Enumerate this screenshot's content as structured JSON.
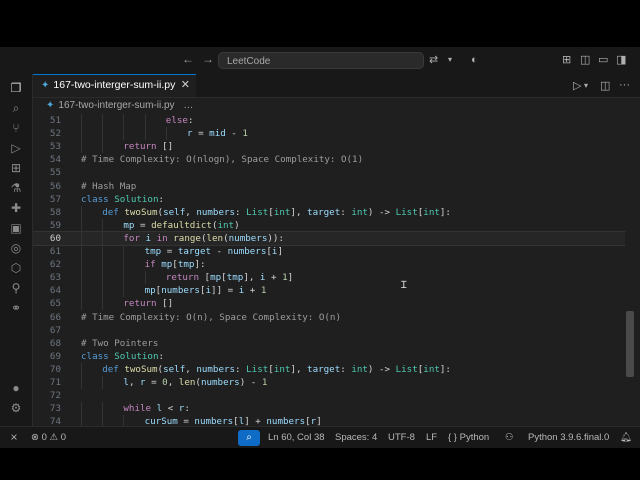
{
  "titlebar": {
    "search_label": "LeetCode",
    "back_icon": "arrow-left-icon",
    "forward_icon": "arrow-right-icon"
  },
  "tab": {
    "label": "167-two-interger-sum-ii.py",
    "close": "✕"
  },
  "breadcrumb": {
    "file": "167-two-interger-sum-ii.py",
    "more": "…"
  },
  "code_lines": [
    {
      "n": "51",
      "indent": 4,
      "tokens": [
        [
          "k",
          "else"
        ],
        [
          "o",
          ":"
        ]
      ]
    },
    {
      "n": "52",
      "indent": 5,
      "tokens": [
        [
          "v",
          "r"
        ],
        [
          "o",
          " = "
        ],
        [
          "v",
          "mid"
        ],
        [
          "o",
          " - "
        ],
        [
          "n",
          "1"
        ]
      ]
    },
    {
      "n": "53",
      "indent": 2,
      "tokens": [
        [
          "k",
          "return"
        ],
        [
          "o",
          " []"
        ]
      ]
    },
    {
      "n": "54",
      "indent": 0,
      "tokens": [
        [
          "cm",
          "# Time Complexity: O(nlogn), Space Complexity: O(1)"
        ]
      ]
    },
    {
      "n": "55",
      "indent": 0,
      "tokens": []
    },
    {
      "n": "56",
      "indent": 0,
      "tokens": [
        [
          "cm",
          "# Hash Map"
        ]
      ]
    },
    {
      "n": "57",
      "indent": 0,
      "tokens": [
        [
          "kw",
          "class"
        ],
        [
          "o",
          " "
        ],
        [
          "c",
          "Solution"
        ],
        [
          "o",
          ":"
        ]
      ]
    },
    {
      "n": "58",
      "indent": 1,
      "tokens": [
        [
          "kw",
          "def"
        ],
        [
          "o",
          " "
        ],
        [
          "f",
          "twoSum"
        ],
        [
          "o",
          "("
        ],
        [
          "v",
          "self"
        ],
        [
          "o",
          ", "
        ],
        [
          "v",
          "numbers"
        ],
        [
          "o",
          ": "
        ],
        [
          "c",
          "List"
        ],
        [
          "o",
          "["
        ],
        [
          "c",
          "int"
        ],
        [
          "o",
          "], "
        ],
        [
          "v",
          "target"
        ],
        [
          "o",
          ": "
        ],
        [
          "c",
          "int"
        ],
        [
          "o",
          ") -> "
        ],
        [
          "c",
          "List"
        ],
        [
          "o",
          "["
        ],
        [
          "c",
          "int"
        ],
        [
          "o",
          "]:"
        ]
      ]
    },
    {
      "n": "59",
      "indent": 2,
      "tokens": [
        [
          "v",
          "mp"
        ],
        [
          "o",
          " = "
        ],
        [
          "f",
          "defaultdict"
        ],
        [
          "o",
          "("
        ],
        [
          "c",
          "int"
        ],
        [
          "o",
          ")"
        ]
      ]
    },
    {
      "n": "60",
      "indent": 2,
      "tokens": [
        [
          "k",
          "for"
        ],
        [
          "o",
          " "
        ],
        [
          "v",
          "i"
        ],
        [
          "o",
          " "
        ],
        [
          "k",
          "in"
        ],
        [
          "o",
          " "
        ],
        [
          "f",
          "range"
        ],
        [
          "o",
          "("
        ],
        [
          "f",
          "len"
        ],
        [
          "o",
          "("
        ],
        [
          "v",
          "numbers"
        ],
        [
          "o",
          "))"
        ],
        [
          "o",
          ":"
        ]
      ]
    },
    {
      "n": "61",
      "indent": 3,
      "tokens": [
        [
          "v",
          "tmp"
        ],
        [
          "o",
          " = "
        ],
        [
          "v",
          "target"
        ],
        [
          "o",
          " - "
        ],
        [
          "v",
          "numbers"
        ],
        [
          "o",
          "["
        ],
        [
          "v",
          "i"
        ],
        [
          "o",
          "]"
        ]
      ]
    },
    {
      "n": "62",
      "indent": 3,
      "tokens": [
        [
          "k",
          "if"
        ],
        [
          "o",
          " "
        ],
        [
          "v",
          "mp"
        ],
        [
          "o",
          "["
        ],
        [
          "v",
          "tmp"
        ],
        [
          "o",
          "]:"
        ]
      ]
    },
    {
      "n": "63",
      "indent": 4,
      "tokens": [
        [
          "k",
          "return"
        ],
        [
          "o",
          " ["
        ],
        [
          "v",
          "mp"
        ],
        [
          "o",
          "["
        ],
        [
          "v",
          "tmp"
        ],
        [
          "o",
          "], "
        ],
        [
          "v",
          "i"
        ],
        [
          "o",
          " + "
        ],
        [
          "n",
          "1"
        ],
        [
          "o",
          "]"
        ]
      ]
    },
    {
      "n": "64",
      "indent": 3,
      "tokens": [
        [
          "v",
          "mp"
        ],
        [
          "o",
          "["
        ],
        [
          "v",
          "numbers"
        ],
        [
          "o",
          "["
        ],
        [
          "v",
          "i"
        ],
        [
          "o",
          "]] = "
        ],
        [
          "v",
          "i"
        ],
        [
          "o",
          " + "
        ],
        [
          "n",
          "1"
        ]
      ]
    },
    {
      "n": "65",
      "indent": 2,
      "tokens": [
        [
          "k",
          "return"
        ],
        [
          "o",
          " []"
        ]
      ]
    },
    {
      "n": "66",
      "indent": 0,
      "tokens": [
        [
          "cm",
          "# Time Complexity: O(n), Space Complexity: O(n)"
        ]
      ]
    },
    {
      "n": "67",
      "indent": 0,
      "tokens": []
    },
    {
      "n": "68",
      "indent": 0,
      "tokens": [
        [
          "cm",
          "# Two Pointers"
        ]
      ]
    },
    {
      "n": "69",
      "indent": 0,
      "tokens": [
        [
          "kw",
          "class"
        ],
        [
          "o",
          " "
        ],
        [
          "c",
          "Solution"
        ],
        [
          "o",
          ":"
        ]
      ]
    },
    {
      "n": "70",
      "indent": 1,
      "tokens": [
        [
          "kw",
          "def"
        ],
        [
          "o",
          " "
        ],
        [
          "f",
          "twoSum"
        ],
        [
          "o",
          "("
        ],
        [
          "v",
          "self"
        ],
        [
          "o",
          ", "
        ],
        [
          "v",
          "numbers"
        ],
        [
          "o",
          ": "
        ],
        [
          "c",
          "List"
        ],
        [
          "o",
          "["
        ],
        [
          "c",
          "int"
        ],
        [
          "o",
          "], "
        ],
        [
          "v",
          "target"
        ],
        [
          "o",
          ": "
        ],
        [
          "c",
          "int"
        ],
        [
          "o",
          ") -> "
        ],
        [
          "c",
          "List"
        ],
        [
          "o",
          "["
        ],
        [
          "c",
          "int"
        ],
        [
          "o",
          "]:"
        ]
      ]
    },
    {
      "n": "71",
      "indent": 2,
      "tokens": [
        [
          "v",
          "l"
        ],
        [
          "o",
          ", "
        ],
        [
          "v",
          "r"
        ],
        [
          "o",
          " = "
        ],
        [
          "n",
          "0"
        ],
        [
          "o",
          ", "
        ],
        [
          "f",
          "len"
        ],
        [
          "o",
          "("
        ],
        [
          "v",
          "numbers"
        ],
        [
          "o",
          ") - "
        ],
        [
          "n",
          "1"
        ]
      ]
    },
    {
      "n": "72",
      "indent": 0,
      "tokens": []
    },
    {
      "n": "73",
      "indent": 2,
      "tokens": [
        [
          "k",
          "while"
        ],
        [
          "o",
          " "
        ],
        [
          "v",
          "l"
        ],
        [
          "o",
          " < "
        ],
        [
          "v",
          "r"
        ],
        [
          "o",
          ":"
        ]
      ]
    },
    {
      "n": "74",
      "indent": 3,
      "tokens": [
        [
          "v",
          "curSum"
        ],
        [
          "o",
          " = "
        ],
        [
          "v",
          "numbers"
        ],
        [
          "o",
          "["
        ],
        [
          "v",
          "l"
        ],
        [
          "o",
          "] + "
        ],
        [
          "v",
          "numbers"
        ],
        [
          "o",
          "["
        ],
        [
          "v",
          "r"
        ],
        [
          "o",
          "]"
        ]
      ]
    }
  ],
  "current_line": "60",
  "statusbar": {
    "errors": "0",
    "warnings": "0",
    "position": "Ln 60, Col 38",
    "spaces": "Spaces: 4",
    "encoding": "UTF-8",
    "eol": "LF",
    "language": "Python",
    "interpreter": "Python 3.9.6.final.0",
    "lang_braces": "{ }"
  }
}
